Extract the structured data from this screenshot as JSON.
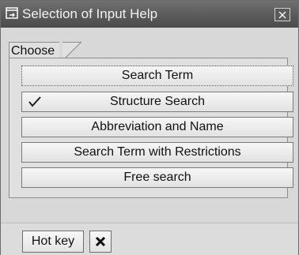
{
  "window": {
    "title": "Selection of Input Help",
    "icons": {
      "title": "window-arrow-icon",
      "close": "close-icon"
    }
  },
  "group": {
    "label": "Choose",
    "options": [
      {
        "label": "Search Term",
        "focused": true,
        "checked": false
      },
      {
        "label": "Structure Search",
        "focused": false,
        "checked": true
      },
      {
        "label": "Abbreviation and Name",
        "focused": false,
        "checked": false
      },
      {
        "label": "Search Term with Restrictions",
        "focused": false,
        "checked": false
      },
      {
        "label": "Free search",
        "focused": false,
        "checked": false
      }
    ]
  },
  "footer": {
    "hotkey_label": "Hot key",
    "cancel_icon": "cancel-x-icon"
  },
  "colors": {
    "titlebar": "#555555",
    "panel": "#e0e0e0",
    "button": "#efefef"
  }
}
